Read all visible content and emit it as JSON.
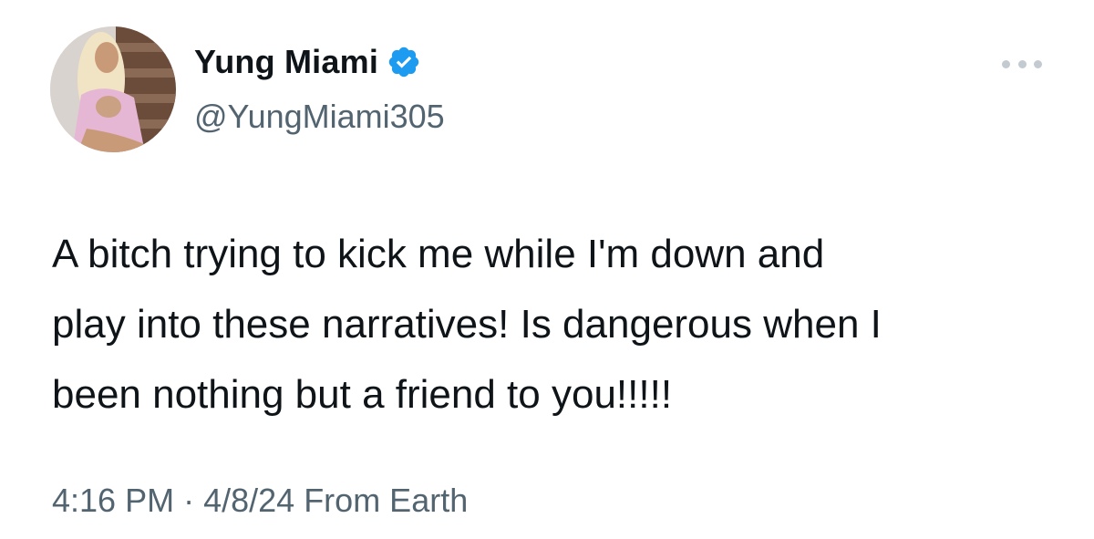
{
  "author": {
    "display_name": "Yung Miami",
    "handle": "@YungMiami305",
    "verified": true,
    "avatar_icon": "profile-photo",
    "verified_icon": "verified-badge-icon",
    "verified_color": "#1d9bf0"
  },
  "menu": {
    "icon": "more-options-icon"
  },
  "tweet": {
    "text": "A bitch trying to kick me while I'm down and\nplay into these narratives! Is dangerous when I\nbeen nothing but a friend to you!!!!!"
  },
  "meta": {
    "time": "4:16 PM",
    "separator": "·",
    "date": "4/8/24",
    "source": "From Earth"
  },
  "colors": {
    "text_primary": "#0f1419",
    "text_secondary": "#536471",
    "background": "#ffffff"
  }
}
